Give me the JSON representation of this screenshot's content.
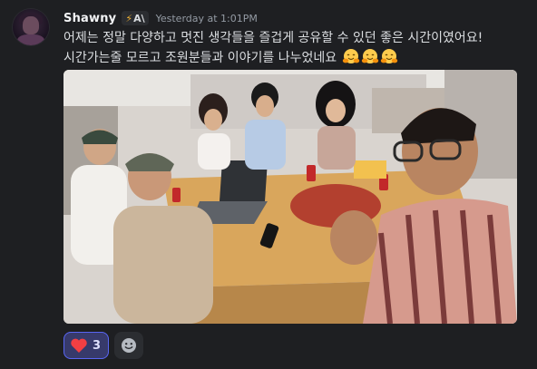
{
  "message": {
    "author": "Shawny",
    "badge": {
      "icon": "lightning-bolt-icon",
      "text": "A\\"
    },
    "timestamp": "Yesterday at 1:01PM",
    "text_line1": "어제는 정말 다양하고 멋진 생각들을 즐겁게 공유할 수 있던 좋은 시간이였어요!",
    "text_line2": "시간가는줄 모르고 조원분들과 이야기를 나누었네요",
    "emojis": [
      "hugging-face-emoji",
      "hugging-face-emoji",
      "hugging-face-emoji"
    ],
    "attachment": {
      "type": "image",
      "description_icon": "group-photo-image"
    }
  },
  "reactions": [
    {
      "icon": "red-heart-icon",
      "count": "3",
      "selected": true
    }
  ],
  "add_reaction": {
    "icon": "add-reaction-icon"
  },
  "colors": {
    "background": "#1e1f22",
    "text": "#dbdee1",
    "muted": "#949ba4",
    "reaction_bg": "#373a6b",
    "reaction_border": "#5865f2",
    "heart": "#f23f43"
  }
}
